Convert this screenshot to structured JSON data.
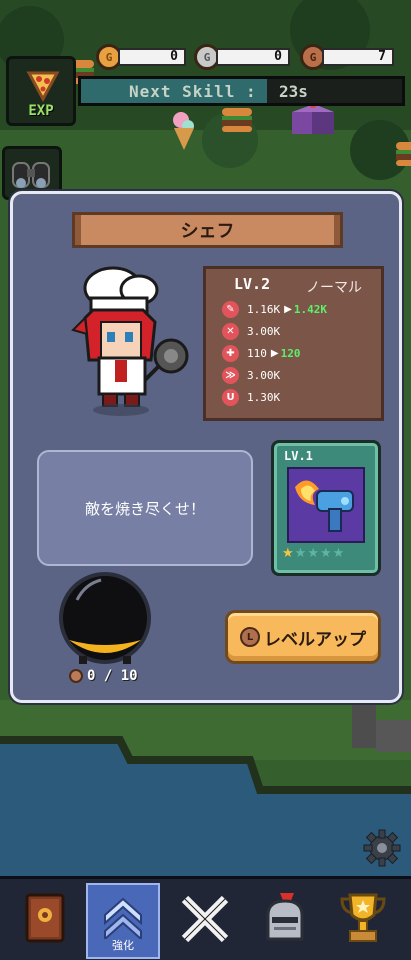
{
  "hud": {
    "exp_label": "EXP",
    "currencies": [
      {
        "icon": "gold-coin-icon",
        "letter": "G",
        "value": "0"
      },
      {
        "icon": "silver-coin-icon",
        "letter": "G",
        "value": "0"
      },
      {
        "icon": "bronze-coin-icon",
        "letter": "G",
        "value": "7"
      }
    ],
    "next_skill_label": "Next Skill :",
    "next_skill_time": "23s",
    "next_skill_progress": 0.58
  },
  "modal": {
    "title": "シェフ",
    "level": "LV.2",
    "rarity": "ノーマル",
    "stats": [
      {
        "icon": "attack-icon",
        "glyph": "✎",
        "value": "1.16K",
        "upgrade": "1.42K"
      },
      {
        "icon": "range-icon",
        "glyph": "✕",
        "value": "3.00K",
        "upgrade": ""
      },
      {
        "icon": "health-icon",
        "glyph": "✚",
        "value": "110",
        "upgrade": "120"
      },
      {
        "icon": "speed-icon",
        "glyph": "≫",
        "value": "3.00K",
        "upgrade": ""
      },
      {
        "icon": "magnet-icon",
        "glyph": "U",
        "value": "1.30K",
        "upgrade": ""
      }
    ],
    "description": "敵を焼き尽くせ！",
    "weapon": {
      "level": "LV.1",
      "stars": 1,
      "max_stars": 5
    },
    "pot_count": "0 / 10",
    "level_up_coin_letter": "L",
    "level_up_label": "レベルアップ"
  },
  "nav": {
    "items": [
      {
        "name": "book",
        "label": ""
      },
      {
        "name": "upgrade",
        "label": "強化"
      },
      {
        "name": "weapons",
        "label": ""
      },
      {
        "name": "helmet",
        "label": ""
      },
      {
        "name": "trophy",
        "label": ""
      }
    ]
  },
  "colors": {
    "modal_bg": "#5b6484",
    "stat_up": "#5cf06a",
    "level_up_button": "#f7b95b",
    "weapon_card": "#3d8a7a"
  }
}
